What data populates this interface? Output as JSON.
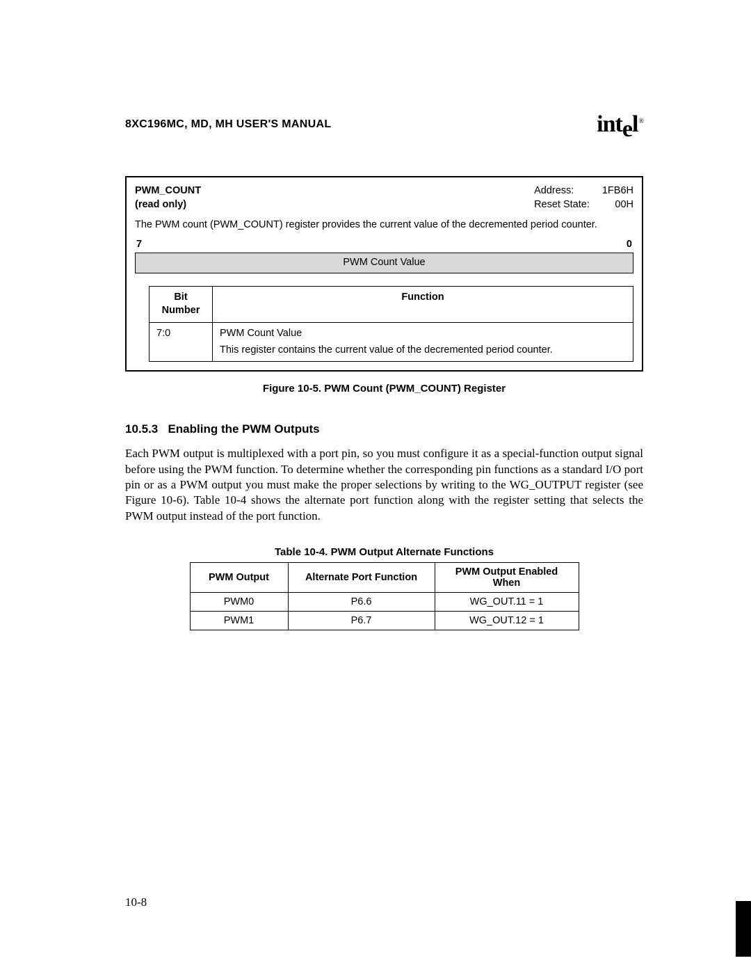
{
  "header": {
    "title": "8XC196MC, MD, MH USER'S MANUAL",
    "logo_text": "intel"
  },
  "register_box": {
    "name": "PWM_COUNT",
    "access": "(read only)",
    "address_label": "Address:",
    "address_value": "1FB6H",
    "reset_label": "Reset State:",
    "reset_value": "00H",
    "description": "The PWM count (PWM_COUNT) register provides the current value of the decremented period counter.",
    "bit_high": "7",
    "bit_low": "0",
    "bit_field_label": "PWM Count Value",
    "func_table": {
      "head_bit": "Bit Number",
      "head_func": "Function",
      "row_bit": "7:0",
      "row_func_title": "PWM Count Value",
      "row_func_desc": "This register contains the current value of the decremented period counter."
    }
  },
  "figure_caption": "Figure 10-5.  PWM Count (PWM_COUNT) Register",
  "section": {
    "number": "10.5.3",
    "title": "Enabling the PWM Outputs"
  },
  "body_text": "Each PWM output is multiplexed with a port pin, so you must configure it as a special-function output signal before using the PWM function. To determine whether the corresponding pin functions as a standard I/O port pin or as a PWM output you must make the proper selections by writing to the WG_OUTPUT register (see Figure 10-6). Table 10-4 shows the alternate port function along with the register setting that selects the PWM output instead of the port function.",
  "table_caption": "Table 10-4.  PWM Output Alternate Functions",
  "alt_table": {
    "head1": "PWM Output",
    "head2": "Alternate Port Function",
    "head3": "PWM Output Enabled When",
    "rows": [
      {
        "c1": "PWM0",
        "c2": "P6.6",
        "c3": "WG_OUT.11 = 1"
      },
      {
        "c1": "PWM1",
        "c2": "P6.7",
        "c3": "WG_OUT.12 = 1"
      }
    ]
  },
  "page_number": "10-8"
}
